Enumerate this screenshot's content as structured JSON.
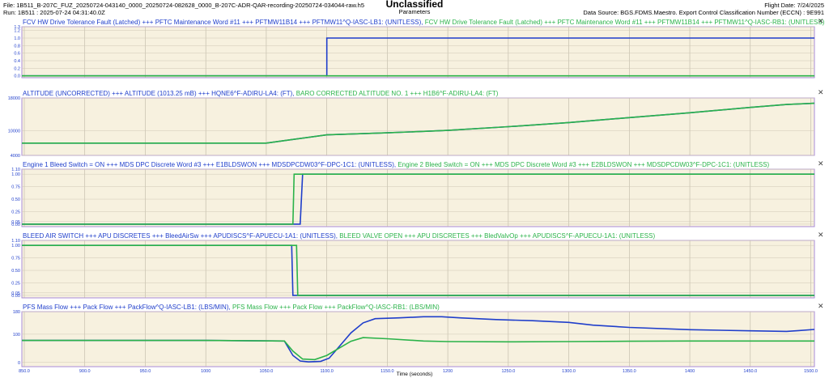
{
  "header": {
    "file": "File: 1B511_B-207C_FUZ_20250724-043140_0000_20250724-082628_0000_B-207C-ADR-QAR-recording-20250724-034044-raw.h5",
    "run": "Run: 1B511 : 2025-07-24 04:31:40.0Z",
    "classification": "Unclassified",
    "subtitle": "Parameters",
    "flight_date": "Flight Date: 7/24/2025",
    "data_source": "Data Source: BGS.FDMS.Maestro. Export Control Classification Number (ECCN) : 9E991"
  },
  "colors": {
    "series1": "#1f3ecb",
    "series2": "#2bb34a",
    "plot_bg": "#f7f1df",
    "border": "#a98bd8"
  },
  "icons": {
    "close": "close-icon"
  },
  "chart_data": [
    {
      "type": "line",
      "legend": [
        "FCV HW Drive Tolerance Fault (Latched) +++ PFTC Maintenance Word #11 +++ PFTMW11B14 +++ PFTMW11^Q-IASC-LB1: (UNITLESS),",
        "FCV HW Drive Tolerance Fault (Latched) +++ PFTC Maintenance Word #11 +++ PFTMW11B14 +++ PFTMW11^Q-IASC-RB1: (UNITLESS)"
      ],
      "ylim": [
        -0.05,
        1.3
      ],
      "yticks": [
        "0.0",
        "0.2",
        "0.4",
        "0.6",
        "0.8",
        "1.0",
        "1.2",
        "1.3"
      ],
      "ytick_values": [
        0,
        0.2,
        0.4,
        0.6,
        0.8,
        1.0,
        1.2,
        1.3
      ],
      "series": [
        {
          "x": [
            848,
            1100,
            1100,
            1503
          ],
          "y": [
            0,
            0,
            1,
            1
          ]
        },
        {
          "x": [
            848,
            1503
          ],
          "y": [
            0,
            0
          ]
        }
      ]
    },
    {
      "type": "line",
      "legend": [
        "ALTITUDE (UNCORRECTED) +++ ALTITUDE (1013.25 mB) +++ HQNE6^F-ADIRU-LA4: (FT),",
        "BARO CORRECTED ALTITUDE NO. 1 +++ H1B6^F-ADIRU-LA4: (FT)"
      ],
      "ylim": [
        4000,
        18000
      ],
      "yticks": [
        "4000",
        "10000",
        "18000"
      ],
      "ytick_values": [
        4000,
        10000,
        18000
      ],
      "series": [
        {
          "x": [
            848,
            1050,
            1070,
            1100,
            1150,
            1200,
            1250,
            1300,
            1350,
            1400,
            1450,
            1480,
            1503
          ],
          "y": [
            7000,
            7000,
            7800,
            9000,
            9500,
            10100,
            11000,
            12000,
            13200,
            14400,
            15700,
            16400,
            16700
          ]
        },
        {
          "x": [
            848,
            1050,
            1070,
            1100,
            1150,
            1200,
            1250,
            1300,
            1350,
            1400,
            1450,
            1480,
            1503
          ],
          "y": [
            7000,
            7000,
            7800,
            9000,
            9500,
            10100,
            11000,
            12000,
            13200,
            14400,
            15700,
            16400,
            16700
          ]
        }
      ]
    },
    {
      "type": "line",
      "legend": [
        "Engine 1 Bleed Switch = ON +++ MDS DPC Discrete Word #3 +++ E1BLDSWON +++ MDSDPCDW03^F-DPC-1C1: (UNITLESS),",
        "Engine 2 Bleed Switch = ON +++ MDS DPC Discrete Word #3 +++ E2BLDSWON +++ MDSDPCDW03^F-DPC-1C1: (UNITLESS)"
      ],
      "ylim": [
        -0.05,
        1.1
      ],
      "yticks": [
        "0.00",
        "0.05",
        "0.25",
        "0.50",
        "0.75",
        "1.00",
        "1.10"
      ],
      "ytick_values": [
        0,
        0.05,
        0.25,
        0.5,
        0.75,
        1.0,
        1.1
      ],
      "series": [
        {
          "x": [
            848,
            1078,
            1080,
            1503
          ],
          "y": [
            0,
            0,
            1,
            1
          ]
        },
        {
          "x": [
            848,
            1072,
            1073,
            1503
          ],
          "y": [
            0,
            0,
            1,
            1
          ]
        }
      ]
    },
    {
      "type": "line",
      "legend": [
        "BLEED AIR SWITCH +++ APU DISCRETES +++ BleedAirSw +++ APUDISCS^F-APUECU-1A1: (UNITLESS),",
        "BLEED VALVE OPEN +++ APU DISCRETES +++ BledValvOp +++ APUDISCS^F-APUECU-1A1: (UNITLESS)"
      ],
      "ylim": [
        -0.05,
        1.1
      ],
      "yticks": [
        "0.00",
        "0.05",
        "0.25",
        "0.50",
        "0.75",
        "1.00",
        "1.10"
      ],
      "ytick_values": [
        0,
        0.05,
        0.25,
        0.5,
        0.75,
        1.0,
        1.1
      ],
      "series": [
        {
          "x": [
            848,
            1071,
            1072,
            1503
          ],
          "y": [
            1,
            1,
            0,
            0
          ]
        },
        {
          "x": [
            848,
            1075,
            1076,
            1503
          ],
          "y": [
            1,
            1,
            0,
            0
          ]
        }
      ]
    },
    {
      "type": "line",
      "legend": [
        "PFS Mass Flow +++ Pack Flow +++ PackFlow^Q-IASC-LB1: (LBS/MIN),",
        "PFS Mass Flow +++ Pack Flow +++ PackFlow^Q-IASC-RB1: (LBS/MIN)"
      ],
      "ylim": [
        -15,
        180
      ],
      "yticks": [
        "0",
        "100",
        "180"
      ],
      "ytick_values": [
        0,
        100,
        180
      ],
      "xlim": [
        848,
        1503
      ],
      "xticks": [
        "850.0",
        "900.0",
        "950.0",
        "1000",
        "1050.0",
        "1100.0",
        "1150.0",
        "1200",
        "1250.0",
        "1300.0",
        "1350.0",
        "1400",
        "1450.0",
        "1500.0"
      ],
      "xtick_values": [
        850,
        900,
        950,
        1000,
        1050,
        1100,
        1150,
        1200,
        1250,
        1300,
        1350,
        1400,
        1450,
        1500
      ],
      "xlabel": "Time (seconds)",
      "series": [
        {
          "x": [
            848,
            1000,
            1065,
            1072,
            1078,
            1085,
            1095,
            1102,
            1110,
            1120,
            1130,
            1140,
            1160,
            1180,
            1195,
            1210,
            1240,
            1270,
            1300,
            1320,
            1350,
            1400,
            1450,
            1480,
            1490,
            1503
          ],
          "y": [
            78,
            78,
            76,
            25,
            5,
            2,
            4,
            15,
            55,
            105,
            140,
            155,
            158,
            162,
            162,
            158,
            152,
            148,
            142,
            132,
            124,
            116,
            112,
            110,
            113,
            117
          ]
        },
        {
          "x": [
            848,
            1000,
            1065,
            1072,
            1080,
            1090,
            1100,
            1110,
            1120,
            1130,
            1150,
            1180,
            1200,
            1250,
            1300,
            1350,
            1400,
            1450,
            1503
          ],
          "y": [
            78,
            78,
            76,
            40,
            12,
            10,
            25,
            50,
            75,
            88,
            84,
            76,
            74,
            73,
            74,
            75,
            76,
            76,
            76
          ]
        }
      ]
    }
  ]
}
